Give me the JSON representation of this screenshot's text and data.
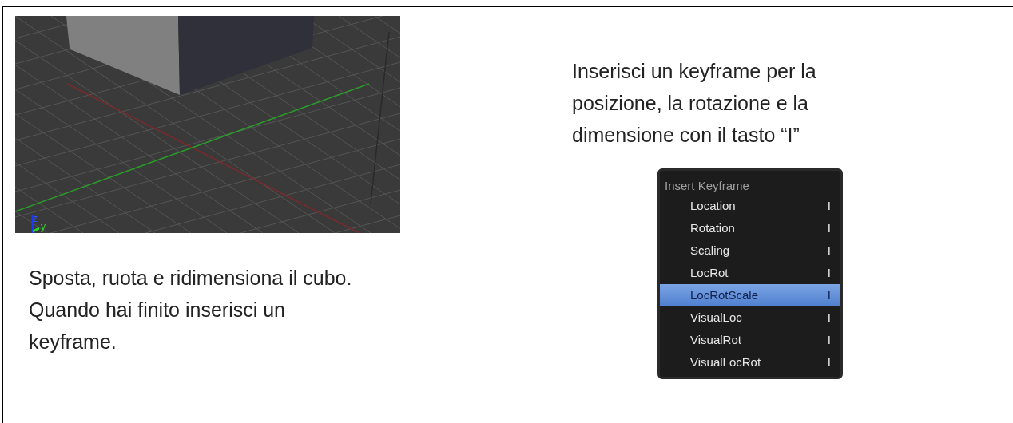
{
  "viewport": {
    "axis_labels": [
      "z",
      "y"
    ]
  },
  "left_text": [
    "Sposta, ruota e ridimensiona il cubo.",
    "Quando hai finito inserisci un keyframe."
  ],
  "right_text": "Inserisci un keyframe per la posizione, la rotazione e la dimensione con il tasto “I”",
  "menu": {
    "title": "Insert Keyframe",
    "items": [
      {
        "label": "Location",
        "shortcut": "I",
        "selected": false
      },
      {
        "label": "Rotation",
        "shortcut": "I",
        "selected": false
      },
      {
        "label": "Scaling",
        "shortcut": "I",
        "selected": false
      },
      {
        "label": "LocRot",
        "shortcut": "I",
        "selected": false
      },
      {
        "label": "LocRotScale",
        "shortcut": "I",
        "selected": true
      },
      {
        "label": "VisualLoc",
        "shortcut": "I",
        "selected": false
      },
      {
        "label": "VisualRot",
        "shortcut": "I",
        "selected": false
      },
      {
        "label": "VisualLocRot",
        "shortcut": "I",
        "selected": false
      }
    ]
  }
}
